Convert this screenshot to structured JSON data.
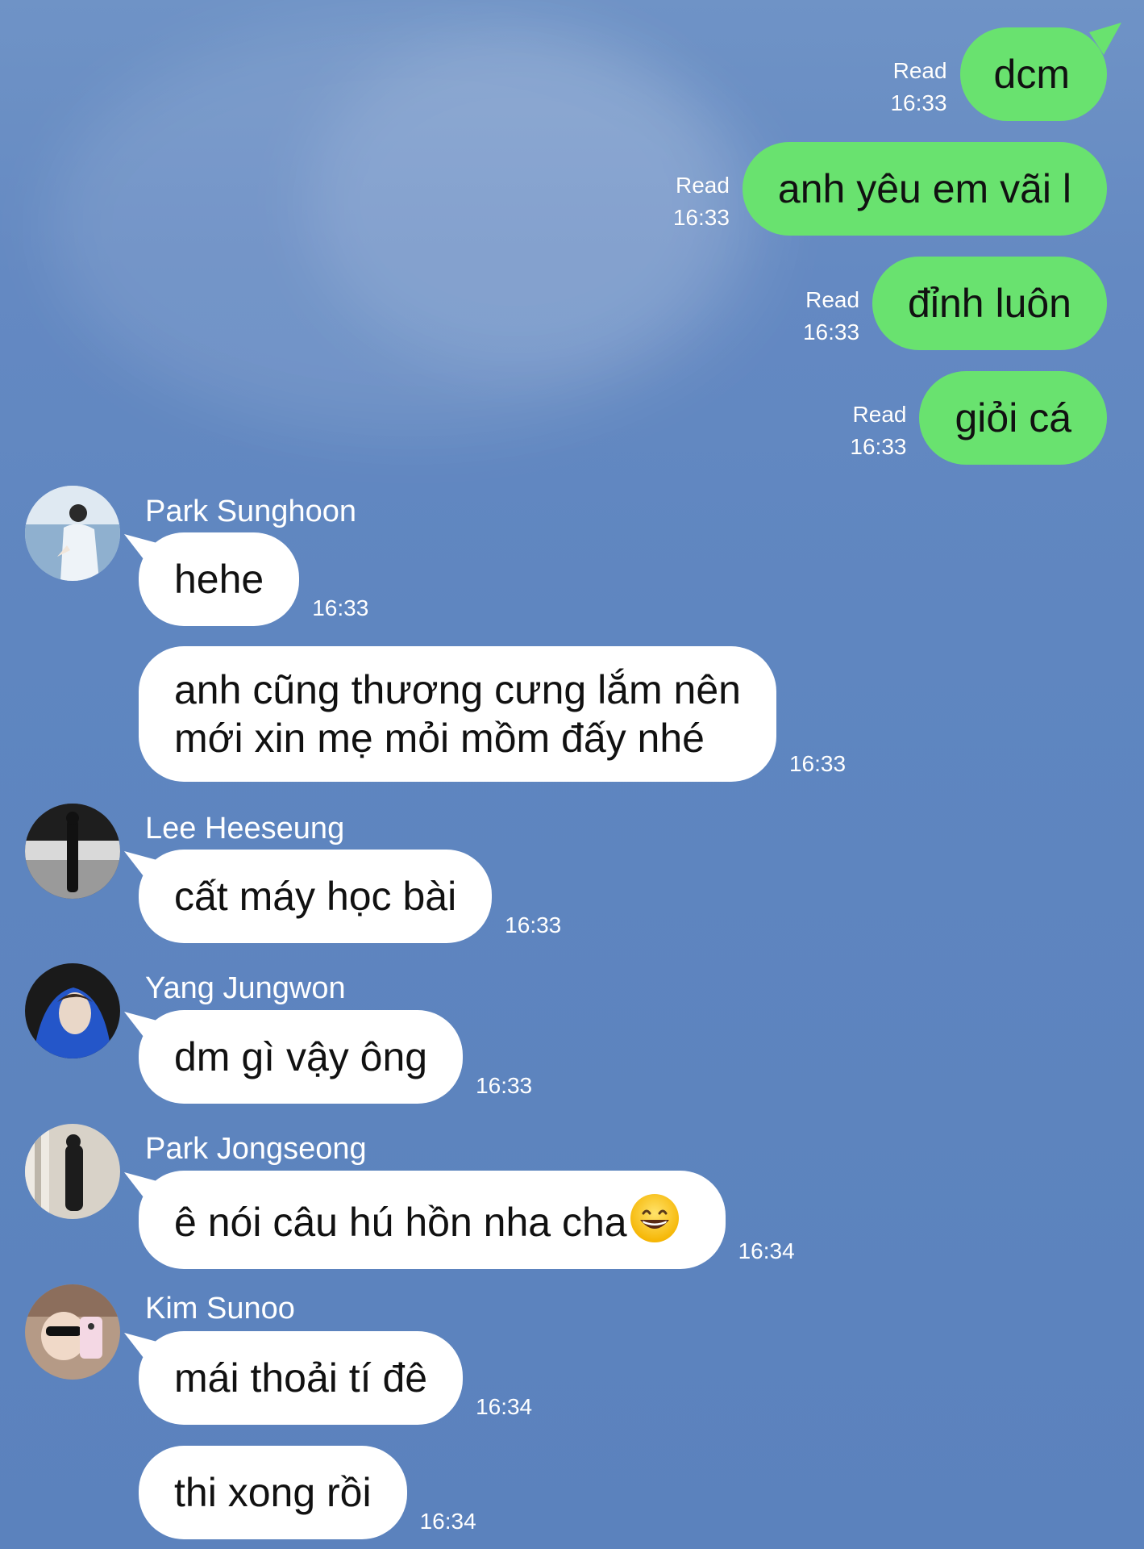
{
  "sent_messages": [
    {
      "status": "Read",
      "time": "16:33",
      "text": "dcm"
    },
    {
      "status": "Read",
      "time": "16:33",
      "text": "anh yêu em vãi l"
    },
    {
      "status": "Read",
      "time": "16:33",
      "text": "đỉnh luôn"
    },
    {
      "status": "Read",
      "time": "16:33",
      "text": "giỏi cá"
    }
  ],
  "received_groups": [
    {
      "sender": "Park Sunghoon",
      "avatar_icon": "avatar-photo",
      "messages": [
        {
          "text": "hehe",
          "time": "16:33"
        },
        {
          "line1": "anh cũng thương cưng lắm nên",
          "line2": "mới xin mẹ mỏi mồm đấy nhé",
          "time": "16:33"
        }
      ]
    },
    {
      "sender": "Lee Heeseung",
      "avatar_icon": "avatar-photo",
      "messages": [
        {
          "text": "cất máy học bài",
          "time": "16:33"
        }
      ]
    },
    {
      "sender": "Yang Jungwon",
      "avatar_icon": "avatar-photo",
      "messages": [
        {
          "text": "dm gì vậy ông",
          "time": "16:33"
        }
      ]
    },
    {
      "sender": "Park Jongseong",
      "avatar_icon": "avatar-photo",
      "messages": [
        {
          "text": "ê nói câu hú hồn nha cha",
          "emoji": "grinning-face-icon",
          "time": "16:34"
        }
      ]
    },
    {
      "sender": "Kim Sunoo",
      "avatar_icon": "avatar-photo",
      "messages": [
        {
          "text": "mái thoải tí đê",
          "time": "16:34"
        },
        {
          "text": "thi xong rồi",
          "time": "16:34"
        }
      ]
    }
  ],
  "colors": {
    "background": "#5f86c0",
    "sent_bubble": "#69e26f",
    "received_bubble": "#ffffff",
    "meta_text": "#ffffff"
  }
}
